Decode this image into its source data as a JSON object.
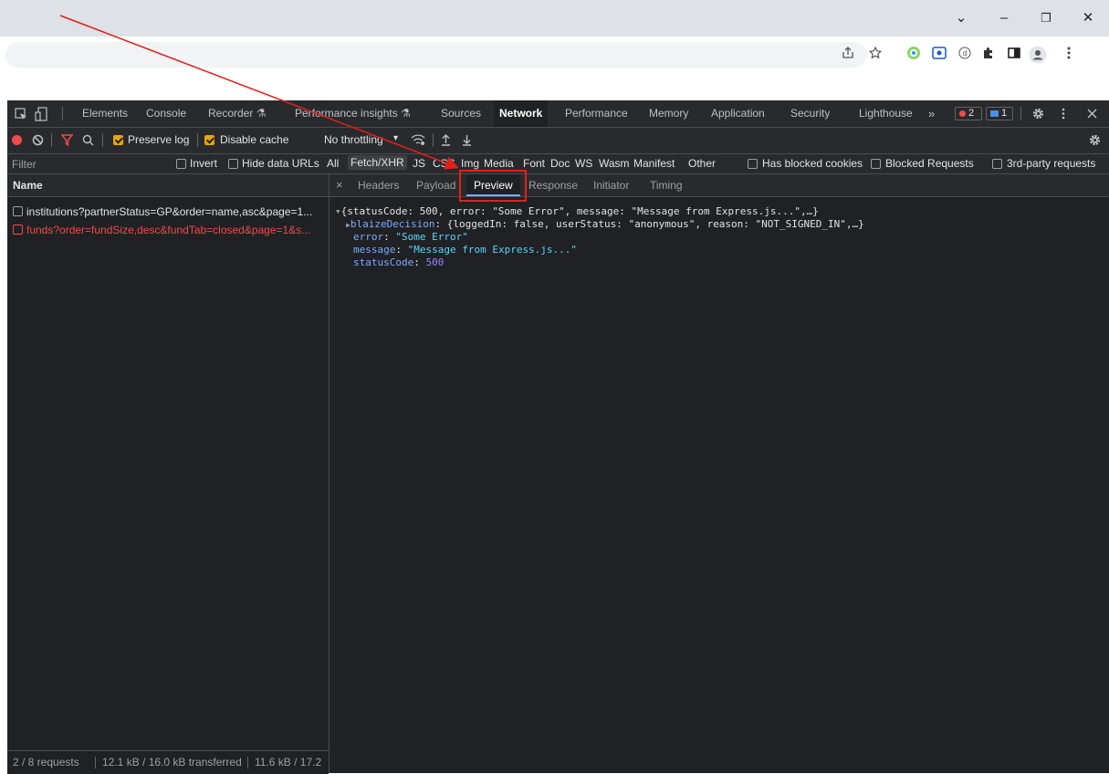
{
  "window": {
    "minimize": "–",
    "restore": "❐",
    "close": "✕",
    "dropdown": "⌄"
  },
  "toolbar_icons": [
    "share-icon",
    "star-icon",
    "extension-green-icon",
    "screencast-icon",
    "extension-d-icon",
    "puzzle-icon",
    "sidepanel-icon",
    "profile-icon",
    "more-icon"
  ],
  "devtools": {
    "tabs": [
      "Elements",
      "Console",
      "Recorder ⚗",
      "Performance insights ⚗",
      "Sources",
      "Network",
      "Performance",
      "Memory",
      "Application",
      "Security",
      "Lighthouse"
    ],
    "active_tab": "Network",
    "more_tabs": "»",
    "error_count": "2",
    "message_count": "1",
    "network_toolbar": {
      "preserve_log": "Preserve log",
      "disable_cache": "Disable cache",
      "throttling": "No throttling",
      "throttle_arrow": "▾"
    },
    "filter": {
      "placeholder": "Filter",
      "invert": "Invert",
      "hide_data_urls": "Hide data URLs",
      "types": [
        "All",
        "Fetch/XHR",
        "JS",
        "CSS",
        "Img",
        "Media",
        "Font",
        "Doc",
        "WS",
        "Wasm",
        "Manifest",
        "Other"
      ],
      "active_type": "Fetch/XHR",
      "has_blocked_cookies": "Has blocked cookies",
      "blocked_requests": "Blocked Requests",
      "third_party": "3rd-party requests"
    },
    "requests": {
      "header": "Name",
      "items": [
        {
          "name": "institutions?partnerStatus=GP&order=name,asc&page=1...",
          "error": false
        },
        {
          "name": "funds?order=fundSize,desc&fundTab=closed&page=1&s...",
          "error": true
        }
      ],
      "status": {
        "requests": "2 / 8 requests",
        "transferred": "12.1 kB / 16.0 kB transferred",
        "resources": "11.6 kB / 17.2"
      }
    },
    "detail": {
      "close": "×",
      "tabs": [
        "Headers",
        "Payload",
        "Preview",
        "Response",
        "Initiator",
        "Timing"
      ],
      "active_tab": "Preview",
      "preview": {
        "summary": "{statusCode: 500, error: \"Some Error\", message: \"Message from Express.js...\",…}",
        "blaize_key": "blaizeDecision",
        "blaize_value": "{loggedIn: false, userStatus: \"anonymous\", reason: \"NOT_SIGNED_IN\",…}",
        "error_key": "error",
        "error_value": "\"Some Error\"",
        "message_key": "message",
        "message_value": "\"Message from Express.js...\"",
        "status_key": "statusCode",
        "status_value": "500"
      }
    }
  },
  "colors": {
    "annotation": "#e0201b",
    "error_text": "#ee4b4b",
    "accent": "#e8a600"
  }
}
